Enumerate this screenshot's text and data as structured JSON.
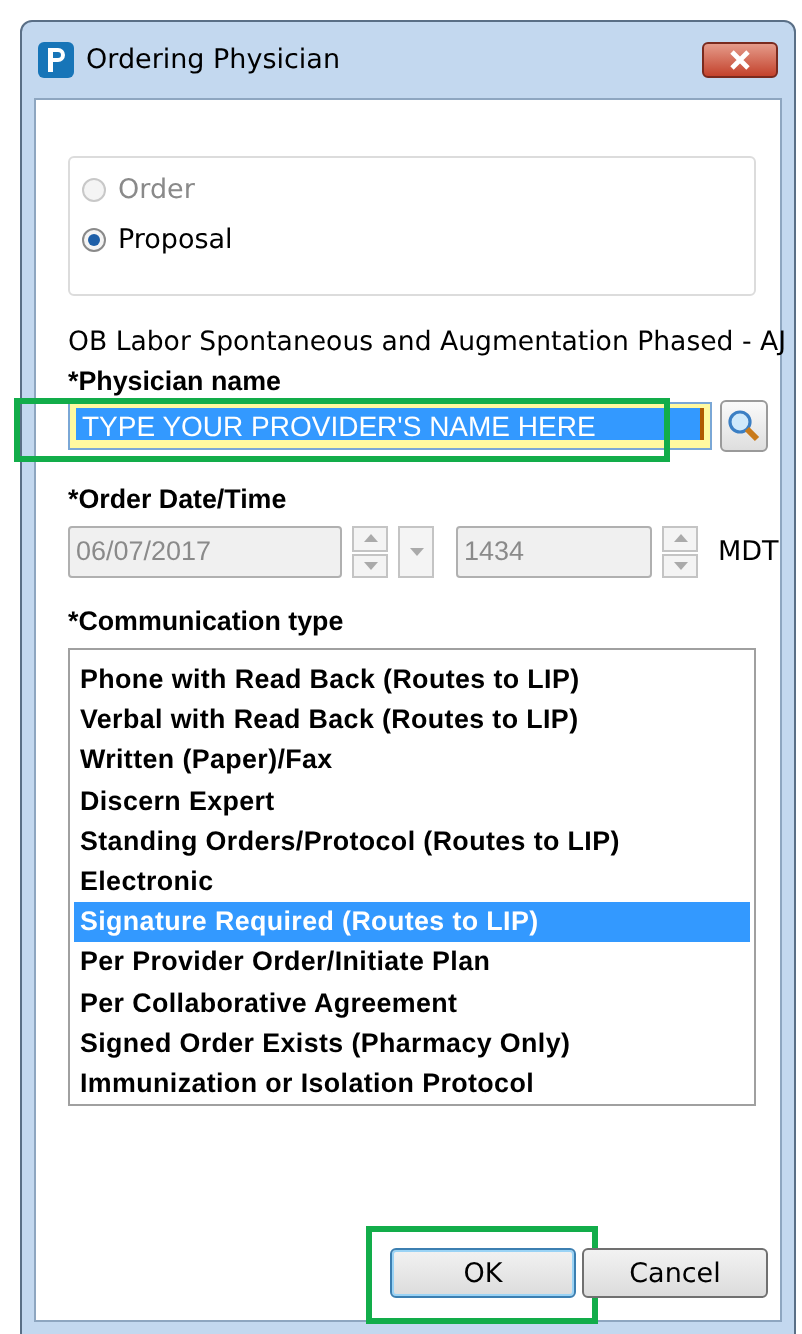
{
  "window": {
    "title": "Ordering Physician"
  },
  "order_mode": [
    {
      "label": "Order",
      "selected": false,
      "disabled": true
    },
    {
      "label": "Proposal",
      "selected": true,
      "disabled": false
    }
  ],
  "order_name": "OB Labor Spontaneous and Augmentation Phased - AJ",
  "physician": {
    "label": "*Physician name",
    "value": "TYPE YOUR PROVIDER'S NAME HERE",
    "highlighted": true
  },
  "order_datetime": {
    "label": "*Order Date/Time",
    "date": "06/07/2017",
    "time": "1434",
    "timezone": "MDT",
    "disabled": true
  },
  "communication_type": {
    "label": "*Communication type",
    "options": [
      {
        "label": "Phone with Read Back (Routes to LIP)",
        "selected": false
      },
      {
        "label": "Verbal with Read Back (Routes to LIP)",
        "selected": false
      },
      {
        "label": "Written (Paper)/Fax",
        "selected": false
      },
      {
        "label": "Discern Expert",
        "selected": false
      },
      {
        "label": "Standing Orders/Protocol (Routes to LIP)",
        "selected": false
      },
      {
        "label": "Electronic",
        "selected": false
      },
      {
        "label": "Signature Required (Routes to LIP)",
        "selected": true
      },
      {
        "label": "Per Provider Order/Initiate Plan",
        "selected": false
      },
      {
        "label": "Per Collaborative Agreement",
        "selected": false
      },
      {
        "label": "Signed Order Exists (Pharmacy Only)",
        "selected": false
      },
      {
        "label": "Immunization or Isolation Protocol",
        "selected": false
      }
    ]
  },
  "buttons": [
    {
      "label": "OK",
      "highlighted": true
    },
    {
      "label": "Cancel",
      "highlighted": false
    }
  ]
}
